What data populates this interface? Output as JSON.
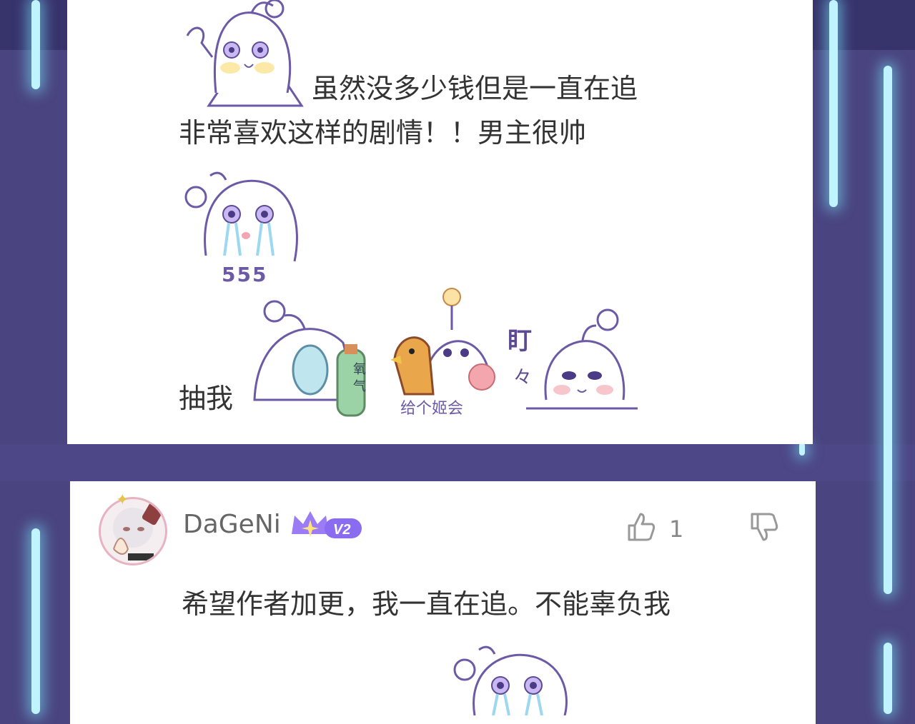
{
  "comment1": {
    "text_line1": "虽然没多少钱但是一直在追",
    "text_line2": "非常喜欢这样的剧情！！男主很帅",
    "sticker_cry_caption": "555",
    "tail_text": "抽我",
    "sticker_oxygen_caption": "氧气",
    "sticker_chicken_caption": "给个姬会",
    "sticker_stare_caption": "盯",
    "sticker_stare_mark": "々"
  },
  "comment2": {
    "username": "DaGeNi",
    "level_badge": "V2",
    "like_count": "1",
    "text": "希望作者加更，我一直在追。不能辜负我"
  },
  "icons": {
    "like": "thumbs-up-icon",
    "dislike": "thumbs-down-icon"
  },
  "colors": {
    "background": "#4a4580",
    "card": "#ffffff",
    "glow": "#bff4ff",
    "badge_purple": "#8a6cf0"
  }
}
